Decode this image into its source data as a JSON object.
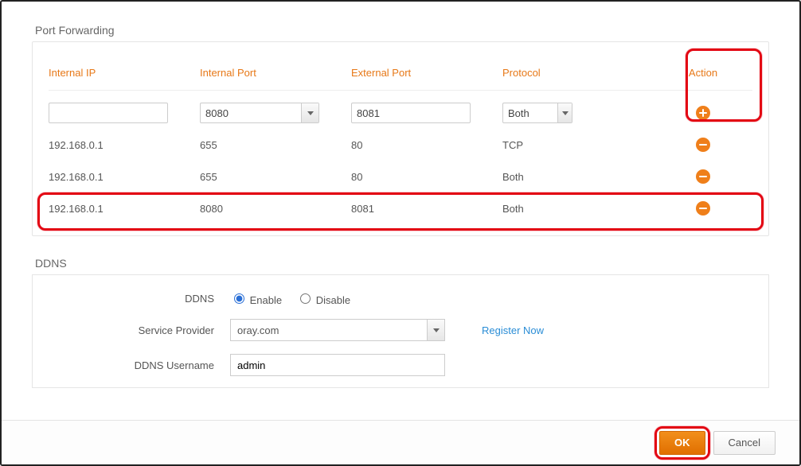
{
  "portForwarding": {
    "title": "Port Forwarding",
    "headers": {
      "internalIp": "Internal IP",
      "internalPort": "Internal Port",
      "externalPort": "External Port",
      "protocol": "Protocol",
      "action": "Action"
    },
    "inputRow": {
      "internalIp": "",
      "internalPort": "8080",
      "externalPort": "8081",
      "protocol": "Both"
    },
    "rows": [
      {
        "ip": "192.168.0.1",
        "iport": "655",
        "eport": "80",
        "proto": "TCP"
      },
      {
        "ip": "192.168.0.1",
        "iport": "655",
        "eport": "80",
        "proto": "Both"
      },
      {
        "ip": "192.168.0.1",
        "iport": "8080",
        "eport": "8081",
        "proto": "Both"
      }
    ]
  },
  "ddns": {
    "title": "DDNS",
    "labels": {
      "ddns": "DDNS",
      "enable": "Enable",
      "disable": "Disable",
      "serviceProvider": "Service Provider",
      "username": "DDNS Username",
      "registerNow": "Register Now"
    },
    "values": {
      "enabled": true,
      "provider": "oray.com",
      "username": "admin"
    }
  },
  "footer": {
    "ok": "OK",
    "cancel": "Cancel"
  }
}
